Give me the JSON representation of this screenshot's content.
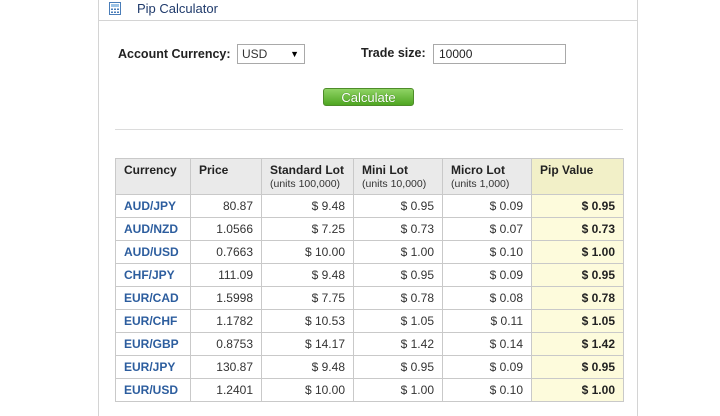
{
  "header": {
    "title": "Pip Calculator",
    "icon": "calculator-icon"
  },
  "form": {
    "account_currency_label": "Account Currency:",
    "account_currency_value": "USD",
    "trade_size_label": "Trade size:",
    "trade_size_value": "10000",
    "calculate_label": "Calculate"
  },
  "table": {
    "headers": [
      {
        "label": "Currency",
        "sub": ""
      },
      {
        "label": "Price",
        "sub": ""
      },
      {
        "label": "Standard Lot",
        "sub": "(units 100,000)"
      },
      {
        "label": "Mini Lot",
        "sub": "(units 10,000)"
      },
      {
        "label": "Micro Lot",
        "sub": "(units 1,000)"
      },
      {
        "label": "Pip Value",
        "sub": ""
      }
    ],
    "rows": [
      [
        "AUD/JPY",
        "80.87",
        "$ 9.48",
        "$ 0.95",
        "$ 0.09",
        "$ 0.95"
      ],
      [
        "AUD/NZD",
        "1.0566",
        "$ 7.25",
        "$ 0.73",
        "$ 0.07",
        "$ 0.73"
      ],
      [
        "AUD/USD",
        "0.7663",
        "$ 10.00",
        "$ 1.00",
        "$ 0.10",
        "$ 1.00"
      ],
      [
        "CHF/JPY",
        "111.09",
        "$ 9.48",
        "$ 0.95",
        "$ 0.09",
        "$ 0.95"
      ],
      [
        "EUR/CAD",
        "1.5998",
        "$ 7.75",
        "$ 0.78",
        "$ 0.08",
        "$ 0.78"
      ],
      [
        "EUR/CHF",
        "1.1782",
        "$ 10.53",
        "$ 1.05",
        "$ 0.11",
        "$ 1.05"
      ],
      [
        "EUR/GBP",
        "0.8753",
        "$ 14.17",
        "$ 1.42",
        "$ 0.14",
        "$ 1.42"
      ],
      [
        "EUR/JPY",
        "130.87",
        "$ 9.48",
        "$ 0.95",
        "$ 0.09",
        "$ 0.95"
      ],
      [
        "EUR/USD",
        "1.2401",
        "$ 10.00",
        "$ 1.00",
        "$ 0.10",
        "$ 1.00"
      ]
    ]
  },
  "colors": {
    "link": "#2c5d9e",
    "button": "#5cb32c",
    "pip_highlight": "#fdfbdc"
  }
}
